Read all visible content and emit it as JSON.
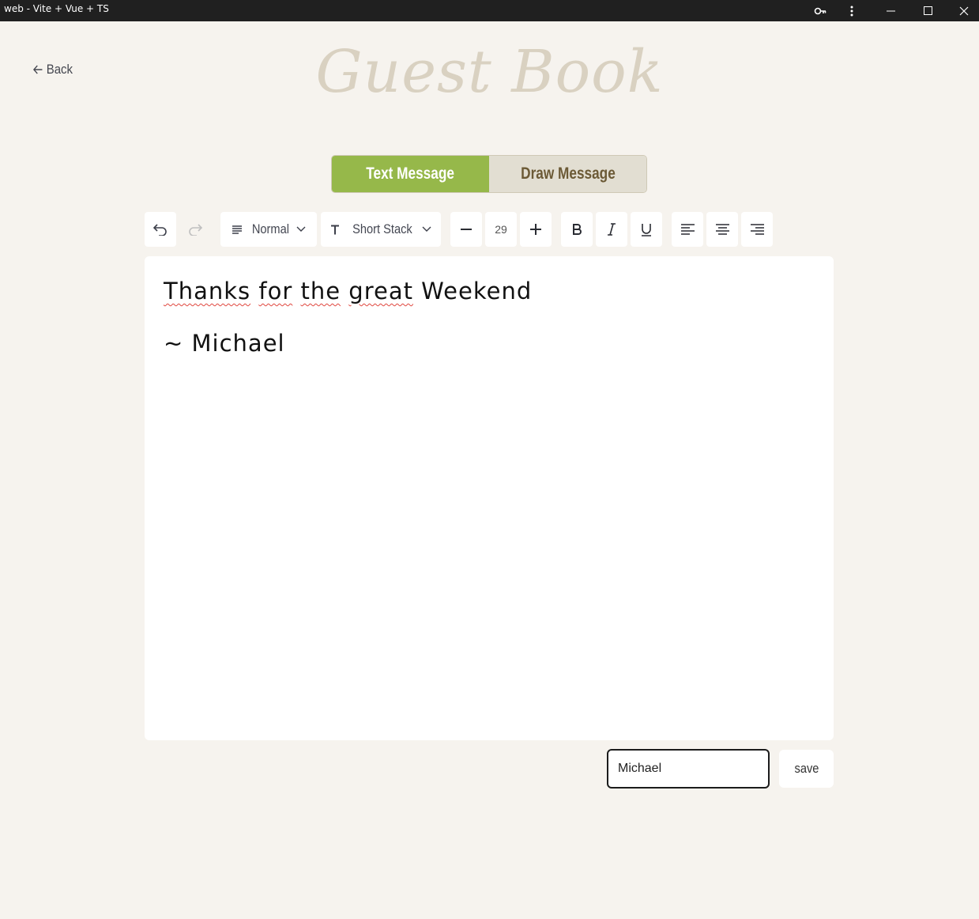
{
  "window": {
    "title": "web - Vite + Vue + TS",
    "icons": [
      "key-icon",
      "kebab-menu-icon",
      "minimize-icon",
      "maximize-icon",
      "close-icon"
    ]
  },
  "nav": {
    "back_label": "Back",
    "back_icon": "arrow-left-icon"
  },
  "page": {
    "title": "Guest Book"
  },
  "tabs": [
    {
      "label": "Text Message",
      "active": true,
      "color": "#96b84a"
    },
    {
      "label": "Draw Message",
      "active": false,
      "color": "#e2ded2"
    }
  ],
  "toolbar": {
    "undo_icon": "undo-icon",
    "redo_icon": "redo-icon",
    "paragraph_style": "Normal",
    "font_family": "Short Stack",
    "font_size": "29",
    "decrease_icon": "minus-icon",
    "increase_icon": "plus-icon",
    "bold_icon": "bold-icon",
    "italic_icon": "italic-icon",
    "underline_icon": "underline-icon",
    "align_icons": [
      "align-left-icon",
      "align-center-icon",
      "align-right-icon"
    ]
  },
  "editor": {
    "line1": {
      "words": [
        "Thanks",
        "for",
        "the",
        "great"
      ],
      "rest": " Weekend"
    },
    "line2": "~ Michael"
  },
  "signature": {
    "value": "Michael"
  },
  "actions": {
    "save_label": "save"
  }
}
